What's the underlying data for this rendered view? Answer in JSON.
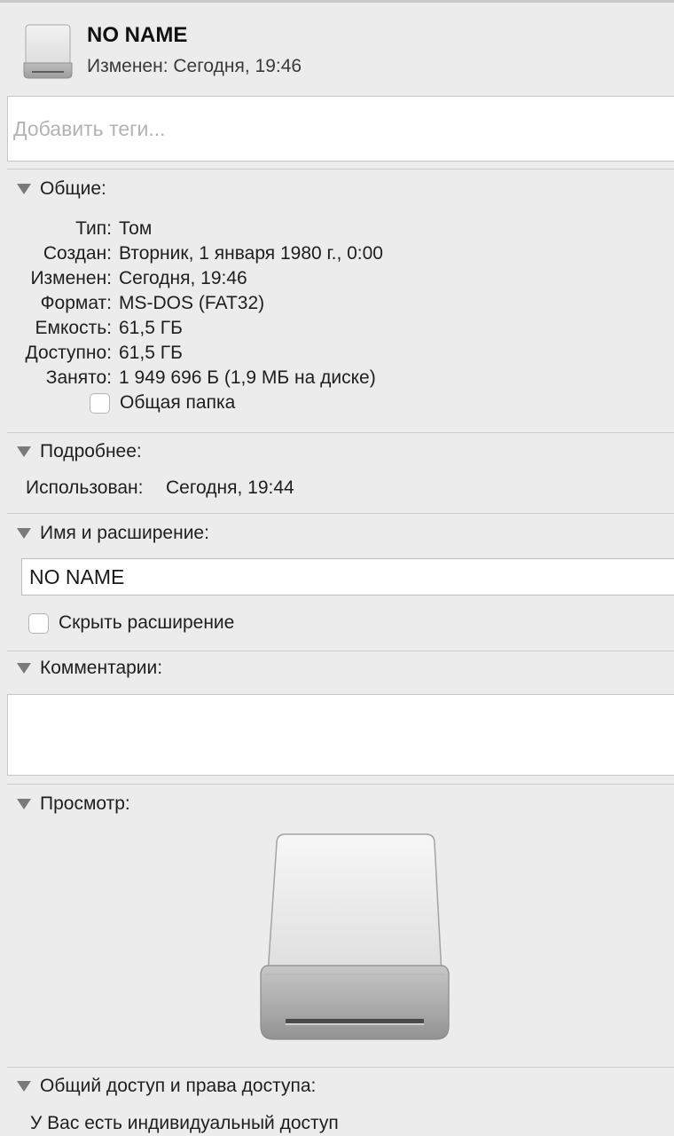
{
  "header": {
    "title": "NO NAME",
    "subtitle": "Изменен: Сегодня, 19:46"
  },
  "tags": {
    "placeholder": "Добавить теги..."
  },
  "general": {
    "title": "Общие:",
    "rows": [
      {
        "label": "Тип:",
        "value": "Том"
      },
      {
        "label": "Создан:",
        "value": "Вторник, 1 января 1980 г., 0:00"
      },
      {
        "label": "Изменен:",
        "value": "Сегодня, 19:46"
      },
      {
        "label": "Формат:",
        "value": "MS-DOS (FAT32)"
      },
      {
        "label": "Емкость:",
        "value": "61,5 ГБ"
      },
      {
        "label": "Доступно:",
        "value": "61,5 ГБ"
      },
      {
        "label": "Занято:",
        "value": "1 949 696 Б (1,9 МБ на диске)"
      }
    ],
    "shared_folder_label": "Общая папка"
  },
  "details": {
    "title": "Подробнее:",
    "used_label": "Использован:",
    "used_value": "Сегодня, 19:44"
  },
  "name_ext": {
    "title": "Имя и расширение:",
    "name_value": "NO NAME",
    "hide_ext_label": "Скрыть расширение"
  },
  "comments": {
    "title": "Комментарии:"
  },
  "preview": {
    "title": "Просмотр:",
    "icon": "external-drive-icon"
  },
  "sharing": {
    "title": "Общий доступ и права доступа:",
    "access_text": "У Вас есть индивидуальный доступ"
  }
}
